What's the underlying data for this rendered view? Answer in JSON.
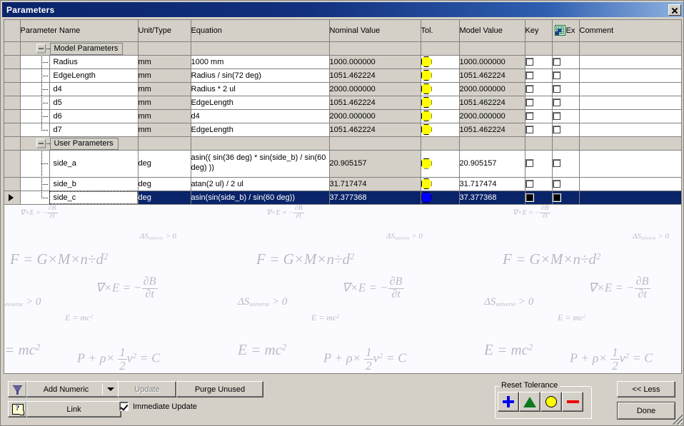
{
  "window": {
    "title": "Parameters",
    "close_label": "✕"
  },
  "grid": {
    "columns": [
      {
        "key": "gutter",
        "label": ""
      },
      {
        "key": "name",
        "label": "Parameter Name"
      },
      {
        "key": "unit",
        "label": "Unit/Type"
      },
      {
        "key": "equation",
        "label": "Equation"
      },
      {
        "key": "nominal",
        "label": "Nominal Value"
      },
      {
        "key": "tol",
        "label": "Tol."
      },
      {
        "key": "model",
        "label": "Model Value"
      },
      {
        "key": "key",
        "label": "Key"
      },
      {
        "key": "export",
        "label": "Ex"
      },
      {
        "key": "comment",
        "label": "Comment"
      }
    ],
    "export_icon_name": "spreadsheet-export-icon",
    "groups": [
      {
        "label": "Model Parameters",
        "expanded": true,
        "rows": [
          {
            "name": "Radius",
            "unit": "mm",
            "equation": "1000 mm",
            "nominal": "1000.000000",
            "tolerance": "yellow",
            "model": "1000.000000",
            "key": false,
            "export": false,
            "comment": "",
            "editable": false
          },
          {
            "name": "EdgeLength",
            "unit": "mm",
            "equation": "Radius / sin(72 deg)",
            "nominal": "1051.462224",
            "tolerance": "yellow",
            "model": "1051.462224",
            "key": false,
            "export": false,
            "comment": "",
            "editable": false
          },
          {
            "name": "d4",
            "unit": "mm",
            "equation": "Radius * 2 ul",
            "nominal": "2000.000000",
            "tolerance": "yellow",
            "model": "2000.000000",
            "key": false,
            "export": false,
            "comment": "",
            "editable": false
          },
          {
            "name": "d5",
            "unit": "mm",
            "equation": "EdgeLength",
            "nominal": "1051.462224",
            "tolerance": "yellow",
            "model": "1051.462224",
            "key": false,
            "export": false,
            "comment": "",
            "editable": false
          },
          {
            "name": "d6",
            "unit": "mm",
            "equation": "d4",
            "nominal": "2000.000000",
            "tolerance": "yellow",
            "model": "2000.000000",
            "key": false,
            "export": false,
            "comment": "",
            "editable": false
          },
          {
            "name": "d7",
            "unit": "mm",
            "equation": "EdgeLength",
            "nominal": "1051.462224",
            "tolerance": "yellow",
            "model": "1051.462224",
            "key": false,
            "export": false,
            "comment": "",
            "editable": false
          }
        ]
      },
      {
        "label": "User Parameters",
        "expanded": true,
        "rows": [
          {
            "name": "side_a",
            "unit": "deg",
            "equation": "asin(( sin(36 deg) * sin(side_b) / sin(60 deg) ))",
            "nominal": "20.905157",
            "tolerance": "yellow",
            "model": "20.905157",
            "key": false,
            "export": false,
            "comment": "",
            "editable": true,
            "tall": true
          },
          {
            "name": "side_b",
            "unit": "deg",
            "equation": "atan(2 ul) / 2 ul",
            "nominal": "31.717474",
            "tolerance": "yellow",
            "model": "31.717474",
            "key": false,
            "export": false,
            "comment": "",
            "editable": true
          },
          {
            "name": "side_c",
            "unit": "deg",
            "equation": "asin(sin(side_b) / sin(60 deg))",
            "nominal": "37.377368",
            "tolerance": "blue",
            "model": "37.377368",
            "key": true,
            "export": true,
            "comment": "",
            "editable": true,
            "selected": true
          }
        ]
      }
    ]
  },
  "toolbar": {
    "filter_icon_name": "filter-funnel-icon",
    "help_icon_name": "help-icon",
    "add_numeric_label": "Add Numeric",
    "update_label": "Update",
    "update_disabled": true,
    "purge_label": "Purge Unused",
    "link_label": "Link",
    "immediate_update_label": "Immediate Update",
    "immediate_update_checked": true,
    "reset_tolerance_legend": "Reset Tolerance",
    "reset_tolerance_buttons": [
      {
        "name": "tolerance-plus",
        "icon": "plus-icon",
        "color": "#0000ee"
      },
      {
        "name": "tolerance-triangle",
        "icon": "triangle-icon",
        "color": "#0a7a1e"
      },
      {
        "name": "tolerance-circle",
        "icon": "circle-icon",
        "color": "#ffff00"
      },
      {
        "name": "tolerance-minus",
        "icon": "minus-icon",
        "color": "#ee0000"
      }
    ],
    "less_label": "<< Less",
    "done_label": "Done"
  },
  "watermark": {
    "equations": [
      "F = G × M × n ÷ d²",
      "ΔS_universe > 0",
      "∇ × E = − ∂B/∂t",
      "E = mc²",
      "P + ρ × ½v² = C"
    ]
  },
  "colors": {
    "title_bar": "#0a246a",
    "window_face": "#d4d0c8",
    "selection": "#0a246a",
    "grid_line": "#808080",
    "tolerance_yellow": "#ffff00",
    "tolerance_blue": "#0000ff"
  }
}
